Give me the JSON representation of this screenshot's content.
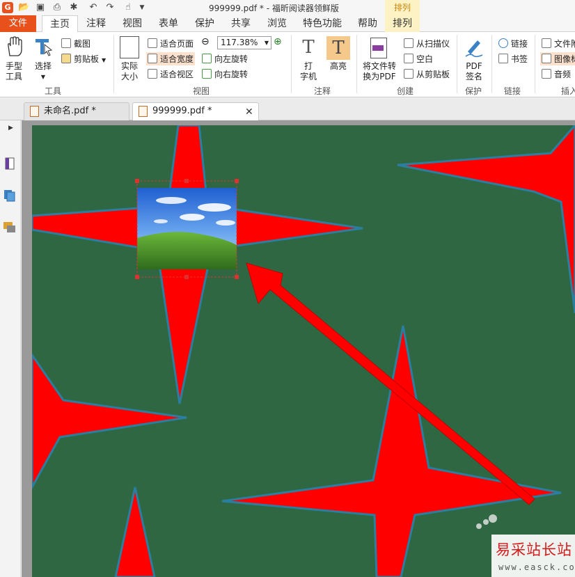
{
  "window": {
    "title": "999999.pdf * - 福昕阅读器领鲜版",
    "context_tab": "排列",
    "logo": "G"
  },
  "quick_access": [
    "open-icon",
    "save-icon",
    "print-icon",
    "new-icon",
    "undo-icon",
    "redo-icon",
    "hand-icon",
    "dropdown-icon"
  ],
  "tabs": [
    {
      "label": "文件"
    },
    {
      "label": "主页"
    },
    {
      "label": "注释"
    },
    {
      "label": "视图"
    },
    {
      "label": "表单"
    },
    {
      "label": "保护"
    },
    {
      "label": "共享"
    },
    {
      "label": "浏览"
    },
    {
      "label": "特色功能"
    },
    {
      "label": "帮助"
    },
    {
      "label": "排列"
    }
  ],
  "ribbon": {
    "tools": {
      "hand_line1": "手型",
      "hand_line2": "工具",
      "select": "选择",
      "screenshot": "截图",
      "clipboard": "剪贴板",
      "group": "工具"
    },
    "view": {
      "actual_line1": "实际",
      "actual_line2": "大小",
      "fit_page": "适合页面",
      "fit_width": "适合宽度",
      "fit_visible": "适合视区",
      "zoom": "117.38%",
      "rotate_left": "向左旋转",
      "rotate_right": "向右旋转",
      "group": "视图"
    },
    "comment": {
      "typewriter_line1": "打",
      "typewriter_line2": "字机",
      "highlight": "高亮",
      "group": "注释"
    },
    "create": {
      "convert_line1": "将文件转",
      "convert_line2": "换为PDF",
      "from_scanner": "从扫描仪",
      "blank": "空白",
      "from_clipboard": "从剪贴板",
      "group": "创建"
    },
    "protect": {
      "sign_line1": "PDF",
      "sign_line2": "签名",
      "group": "保护"
    },
    "links": {
      "link": "链接",
      "bookmark": "书签",
      "group": "链接"
    },
    "insert": {
      "file_attach": "文件附",
      "image": "图像标",
      "audio": "音频",
      "group": "插入"
    }
  },
  "doc_tabs": [
    {
      "label": "未命名.pdf *"
    },
    {
      "label": "999999.pdf *"
    }
  ],
  "watermark": {
    "title": "易采站长站",
    "url": "www.easck.com"
  },
  "colors": {
    "accent": "#e8501c",
    "page_bg": "#2f6743",
    "star": "#ff0000",
    "star_outline": "#2a7fa0",
    "selection": "#e03030"
  }
}
